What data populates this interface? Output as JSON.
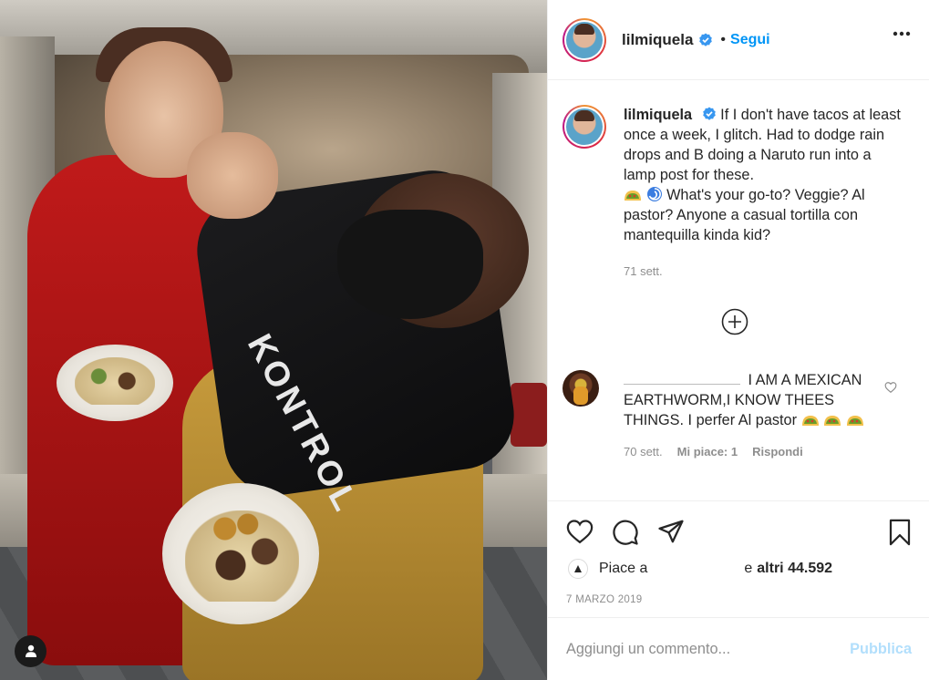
{
  "post": {
    "username": "lilmiquela",
    "follow_label": "Segui",
    "separator": "•",
    "caption": "If I don't have tacos at least once a week, I glitch. Had to dodge rain drops and B doing a Naruto run into a lamp post for these.",
    "caption_after_emoji": "What's your go-to? Veggie? Al pastor? Anyone a casual tortilla con mantequilla kinda kid?",
    "caption_age": "71 sett.",
    "photo_text": "KONTROL"
  },
  "comment": {
    "text_line": "I AM A MEXICAN EARTHWORM,I KNOW THEES THINGS. I perfer Al pastor",
    "age": "70 sett.",
    "likes": "Mi piace: 1",
    "reply": "Rispondi"
  },
  "likes": {
    "prefix": "Piace a",
    "suffix": "e",
    "others": "altri 44.592"
  },
  "date": "7 MARZO 2019",
  "add_comment": {
    "placeholder": "Aggiungi un commento...",
    "publish": "Pubblica"
  },
  "colors": {
    "link_blue": "#0095f6",
    "publish_disabled": "#b2dffc",
    "secondary_text": "#8e8e8e"
  },
  "icons": [
    "verified-badge-icon",
    "more-options-icon",
    "load-more-icon",
    "heart-icon",
    "comment-icon",
    "share-icon",
    "bookmark-icon",
    "user-tag-icon",
    "taco-emoji",
    "cyclone-emoji"
  ]
}
